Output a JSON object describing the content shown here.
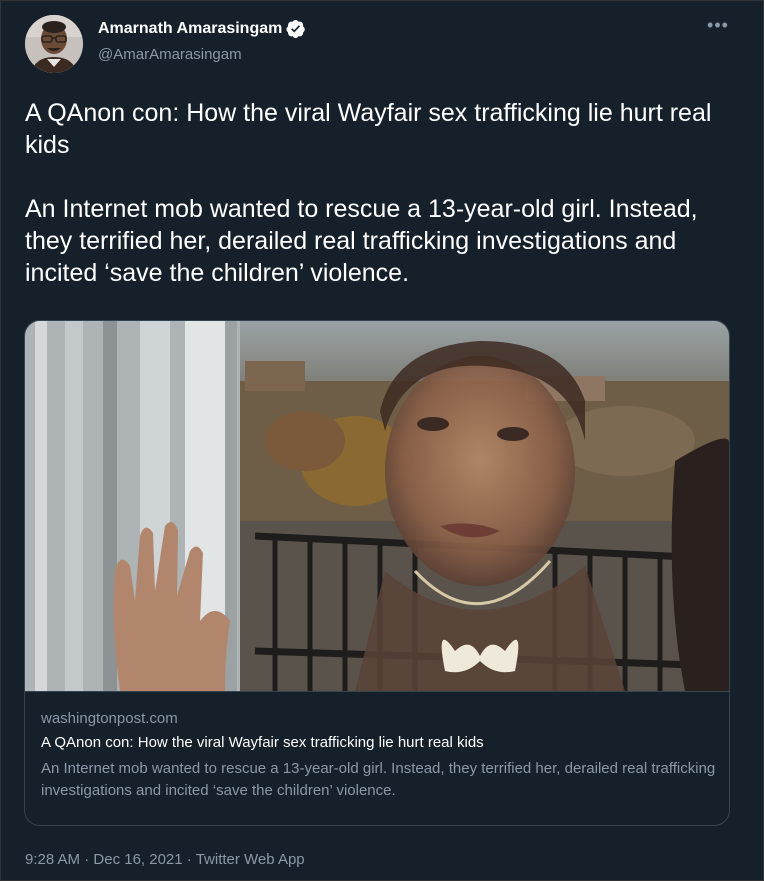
{
  "author": {
    "name": "Amarnath Amarasingam",
    "handle": "@AmarAmarasingam",
    "verified": true
  },
  "more_icon": "•••",
  "tweet": {
    "paragraph_1": "A QAnon con: How the viral Wayfair sex trafficking lie hurt real kids",
    "paragraph_2": "An Internet mob wanted to rescue a 13-year-old girl. Instead, they terrified her, derailed real trafficking investigations and incited ‘save the children’ violence."
  },
  "card": {
    "domain": "washingtonpost.com",
    "title": "A QAnon con: How the viral Wayfair sex trafficking lie hurt real kids",
    "description": "An Internet mob wanted to rescue a 13-year-old girl. Instead, they terrified her, derailed real trafficking investigations and incited ‘save the children’ violence."
  },
  "meta": {
    "time": "9:28 AM",
    "separator_1": " · ",
    "date": "Dec 16, 2021",
    "separator_2": " · ",
    "source": "Twitter Web App"
  },
  "colors": {
    "background": "#15202b",
    "text_primary": "#ffffff",
    "text_secondary": "#8b98a5",
    "verified_blue": "#1d9bf0",
    "border": "#38444d"
  }
}
